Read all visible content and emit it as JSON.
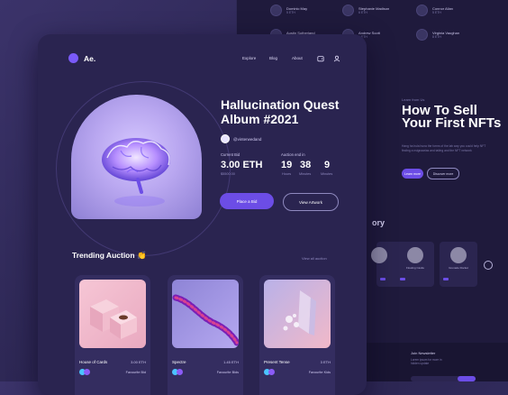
{
  "bg": {
    "users": [
      {
        "name": "Dominic May",
        "sub": "5 ETH"
      },
      {
        "name": "Stephanie Madison",
        "sub": "6 ETH"
      },
      {
        "name": "Connor Allan",
        "sub": "5 ETH"
      },
      {
        "name": "Austin Sutherland",
        "sub": "4 ETH"
      },
      {
        "name": "Andrew Scott",
        "sub": "6 ETH"
      },
      {
        "name": "Virginia Vaughan",
        "sub": "8 ETH"
      }
    ],
    "kicker": "Learn from Us",
    "title": "How To Sell Your First NFTs",
    "desc": "Hang ha hula huna the forms of the lab way you could help NFT finding a nsignaarias and tailing and the NFT network",
    "learn_label": "Learn more",
    "discover_label": "Discover more",
    "section_partial": "ory",
    "cards": [
      {
        "label": "Floating Castle"
      },
      {
        "label": "Grenade Rocket"
      }
    ],
    "newsletter": "Join Newsletter",
    "newsletter_text": "Lorem ipsum for more in hidden update"
  },
  "header": {
    "logo": "Ae.",
    "nav": [
      "Explore",
      "Blog",
      "About"
    ]
  },
  "hero": {
    "title": "Hallucination Quest Album #2021",
    "creator": "@vinterwedand",
    "bid_label": "Current Bid",
    "bid_value": "3.00 ETH",
    "bid_usd": "$5500.00",
    "auction_label": "Auction end in",
    "timer": [
      {
        "value": "19",
        "unit": "Hours"
      },
      {
        "value": "38",
        "unit": "Minutes"
      },
      {
        "value": "9",
        "unit": "Minutes"
      }
    ],
    "place_bid": "Place a Bid",
    "view_artwork": "View Artwork"
  },
  "trending": {
    "title": "Trending Auction",
    "emoji": "👏",
    "view_all": "View all auction",
    "cards": [
      {
        "name": "House of Cards",
        "price": "3.00 ETH",
        "fav": "Favourite Bid"
      },
      {
        "name": "Spectre",
        "price": "1.45 ETH",
        "fav": "Favourite Bids"
      },
      {
        "name": "Present Tense",
        "price": "3 ETH",
        "fav": "Favourite Kids"
      }
    ]
  },
  "colors": {
    "accent": "#6c4de6",
    "bg": "#2a2450"
  }
}
